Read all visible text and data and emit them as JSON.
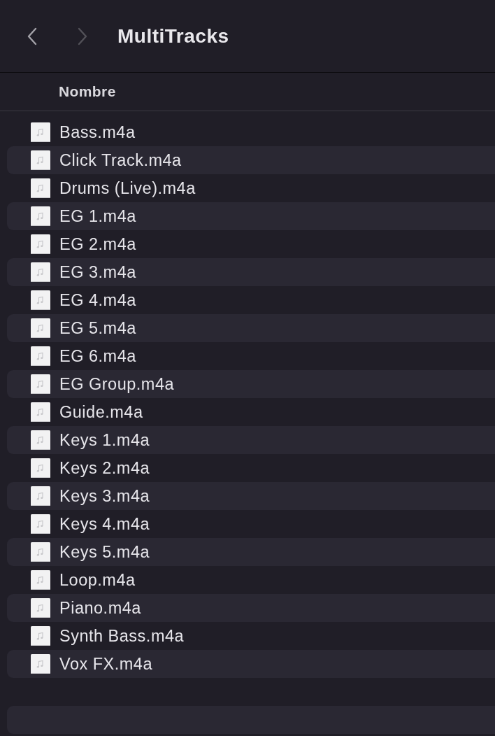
{
  "toolbar": {
    "back": {
      "disabled": false
    },
    "forward": {
      "disabled": true
    },
    "title": "MultiTracks"
  },
  "table": {
    "columns": [
      "Nombre"
    ],
    "rows": [
      {
        "name": "Bass.m4a"
      },
      {
        "name": "Click Track.m4a"
      },
      {
        "name": "Drums (Live).m4a"
      },
      {
        "name": "EG 1.m4a"
      },
      {
        "name": "EG 2.m4a"
      },
      {
        "name": "EG 3.m4a"
      },
      {
        "name": "EG 4.m4a"
      },
      {
        "name": "EG 5.m4a"
      },
      {
        "name": "EG 6.m4a"
      },
      {
        "name": "EG Group.m4a"
      },
      {
        "name": "Guide.m4a"
      },
      {
        "name": "Keys 1.m4a"
      },
      {
        "name": "Keys 2.m4a"
      },
      {
        "name": "Keys 3.m4a"
      },
      {
        "name": "Keys 4.m4a"
      },
      {
        "name": "Keys 5.m4a"
      },
      {
        "name": "Loop.m4a"
      },
      {
        "name": "Piano.m4a"
      },
      {
        "name": "Synth Bass.m4a"
      },
      {
        "name": "Vox FX.m4a"
      }
    ]
  }
}
